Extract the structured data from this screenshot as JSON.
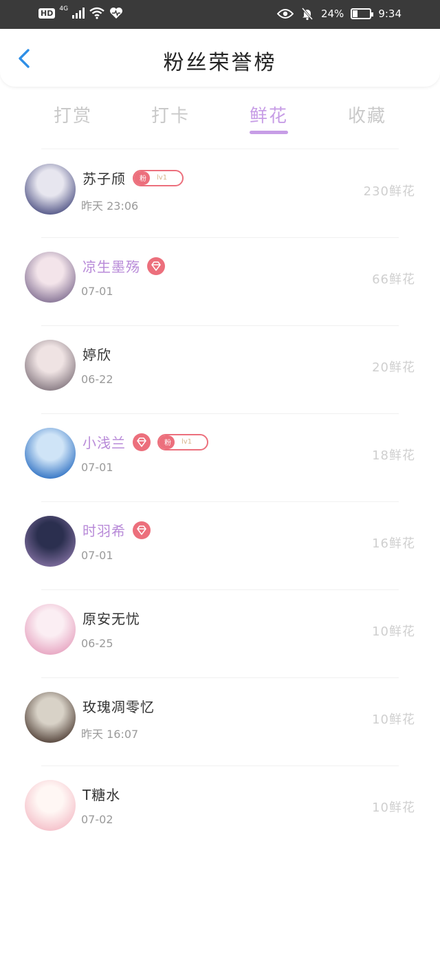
{
  "status_bar": {
    "hd": "HD",
    "network": "4G",
    "battery": "24%",
    "time": "9:34",
    "icons": [
      "signal-icon",
      "wifi-icon",
      "heart-health-icon",
      "eye-icon",
      "mute-bell-icon",
      "battery-icon"
    ]
  },
  "header": {
    "title": "粉丝荣誉榜",
    "back_icon": "chevron-left-icon",
    "accent": "#2f8fe6"
  },
  "tabs": [
    {
      "label": "打赏",
      "active": false
    },
    {
      "label": "打卡",
      "active": false
    },
    {
      "label": "鲜花",
      "active": true
    },
    {
      "label": "收藏",
      "active": false
    }
  ],
  "theme": {
    "tab_active_color": "#c79de6",
    "vip_name_color": "#b88ad8",
    "badge_color": "#ec6f7c"
  },
  "badge": {
    "fan_label": "粉",
    "level_label": "lv1"
  },
  "fans": [
    {
      "name": "苏子颀",
      "vip": false,
      "gem": false,
      "fan_badge": true,
      "time": "昨天 23:06",
      "amount": "230鲜花",
      "avatar": [
        "#e7e6ef",
        "#5a5d8c"
      ]
    },
    {
      "name": "凉生墨殇",
      "vip": true,
      "gem": true,
      "fan_badge": false,
      "time": "07-01",
      "amount": "66鲜花",
      "avatar": [
        "#f3e4ea",
        "#8c7a9a"
      ]
    },
    {
      "name": "婷欣",
      "vip": false,
      "gem": false,
      "fan_badge": false,
      "time": "06-22",
      "amount": "20鲜花",
      "avatar": [
        "#efe3e3",
        "#8d8088"
      ]
    },
    {
      "name": "小浅兰",
      "vip": true,
      "gem": true,
      "fan_badge": true,
      "time": "07-01",
      "amount": "18鲜花",
      "avatar": [
        "#cfe4f7",
        "#3b7ac7"
      ]
    },
    {
      "name": "时羽希",
      "vip": true,
      "gem": true,
      "fan_badge": false,
      "time": "07-01",
      "amount": "16鲜花",
      "avatar": [
        "#2b2f4f",
        "#7a6a9a"
      ]
    },
    {
      "name": "原安无忧",
      "vip": false,
      "gem": false,
      "fan_badge": false,
      "time": "06-25",
      "amount": "10鲜花",
      "avatar": [
        "#fbeef3",
        "#e8a9c4"
      ]
    },
    {
      "name": "玫瑰凋零忆",
      "vip": false,
      "gem": false,
      "fan_badge": false,
      "time": "昨天 16:07",
      "amount": "10鲜花",
      "avatar": [
        "#d8d2c7",
        "#5b4b42"
      ]
    },
    {
      "name": "T糖水",
      "vip": false,
      "gem": false,
      "fan_badge": false,
      "time": "07-02",
      "amount": "10鲜花",
      "avatar": [
        "#fff7f4",
        "#f5c3cc"
      ]
    }
  ]
}
